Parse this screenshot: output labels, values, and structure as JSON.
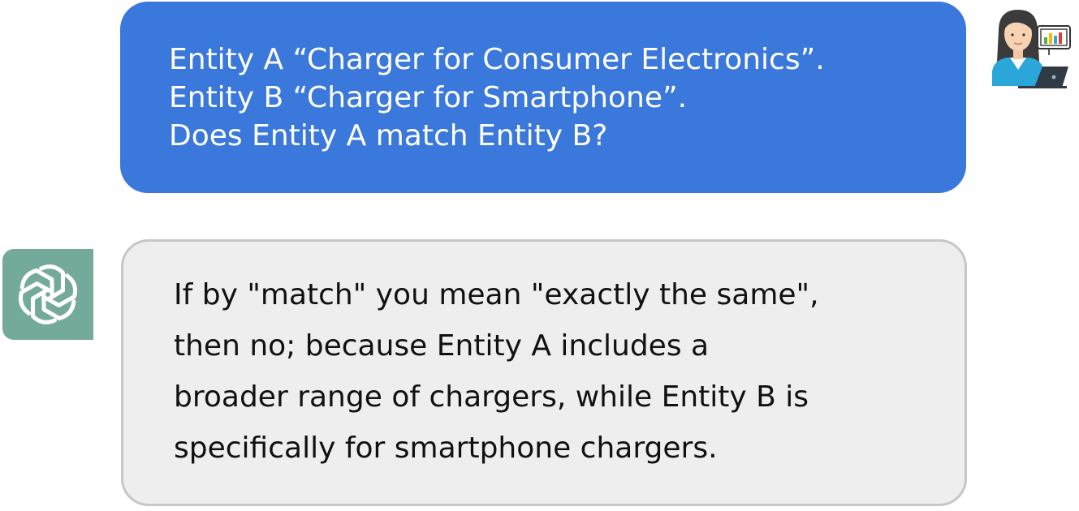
{
  "conversation": {
    "user_message": {
      "lines": [
        "Entity A “Charger for Consumer Electronics”.",
        "Entity B “Charger for Smartphone”.",
        "Does Entity A match Entity B?"
      ],
      "bubble_color": "#3b78db",
      "avatar_icon": "woman-with-laptop-icon"
    },
    "assistant_message": {
      "lines": [
        "If by \"match\" you mean \"exactly the same\",",
        "then no; because Entity A includes a",
        "broader range of chargers, while Entity B is",
        "specifically for smartphone chargers."
      ],
      "bubble_color": "#eeeeee",
      "avatar_icon": "chatgpt-logo-icon",
      "avatar_color": "#74aa9c"
    }
  }
}
